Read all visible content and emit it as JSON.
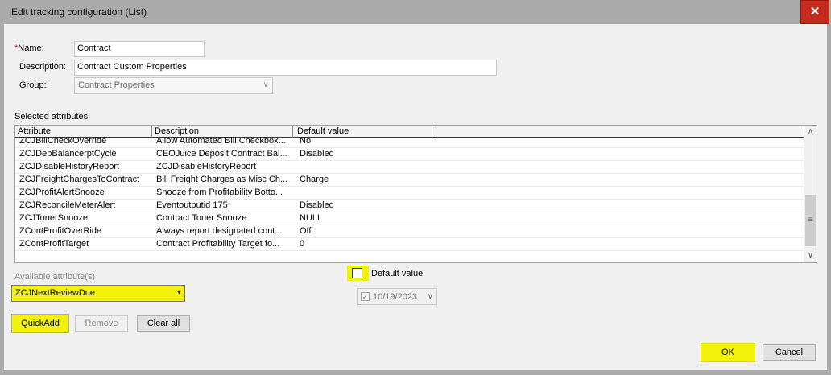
{
  "window": {
    "title": "Edit tracking configuration (List)",
    "close_glyph": "✕"
  },
  "form": {
    "name_required_mark": "*",
    "name_label": "Name:",
    "name_value": "Contract",
    "description_label": "Description:",
    "description_value": "Contract Custom Properties",
    "group_label": "Group:",
    "group_value": "Contract Properties"
  },
  "grid": {
    "section_label": "Selected attributes:",
    "columns": [
      "Attribute",
      "Description",
      "Default value"
    ],
    "rows": [
      {
        "attribute": "ZCJBillCheckOverride",
        "description": "Allow Automated Bill Checkbox...",
        "default": "No"
      },
      {
        "attribute": "ZCJDepBalancerptCycle",
        "description": "CEOJuice Deposit Contract Bal...",
        "default": "Disabled"
      },
      {
        "attribute": "ZCJDisableHistoryReport",
        "description": "ZCJDisableHistoryReport",
        "default": ""
      },
      {
        "attribute": "ZCJFreightChargesToContract",
        "description": "Bill Freight Charges as Misc Ch...",
        "default": "Charge"
      },
      {
        "attribute": "ZCJProfitAlertSnooze",
        "description": "Snooze from Profitability Botto...",
        "default": ""
      },
      {
        "attribute": "ZCJReconcileMeterAlert",
        "description": "Eventoutputid 175",
        "default": "Disabled"
      },
      {
        "attribute": "ZCJTonerSnooze",
        "description": "Contract Toner Snooze",
        "default": "NULL"
      },
      {
        "attribute": "ZContProfitOverRide",
        "description": "Always report designated cont...",
        "default": "Off"
      },
      {
        "attribute": "ZContProfitTarget",
        "description": "Contract Profitability Target fo...",
        "default": "0"
      }
    ]
  },
  "available": {
    "label": "Available attribute(s)",
    "selected": "ZCJNextReviewDue"
  },
  "default_value": {
    "checkbox_label": "Default value",
    "checked": false,
    "date_value": "10/19/2023"
  },
  "buttons": {
    "quickadd": "QuickAdd",
    "remove": "Remove",
    "clear_all": "Clear all",
    "ok": "OK",
    "cancel": "Cancel"
  },
  "colors": {
    "highlight": "#f2f20a",
    "close_red": "#c42b1c",
    "required": "#cc0000"
  }
}
